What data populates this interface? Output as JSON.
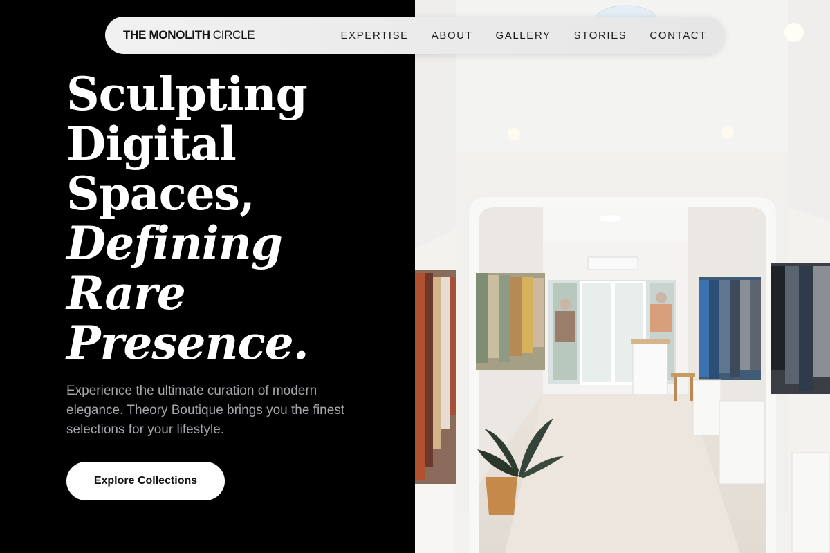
{
  "nav": {
    "logo_bold": "THE MONOLITH",
    "logo_thin": "CIRCLE",
    "links": [
      "EXPERTISE",
      "ABOUT",
      "GALLERY",
      "STORIES",
      "CONTACT"
    ]
  },
  "hero": {
    "headline_lines": [
      "Sculpting",
      "Digital",
      "Spaces,",
      "Defining",
      "Rare",
      "Presence."
    ],
    "subtext": "Experience the ultimate curation of modern elegance. Theory Boutique brings you the finest selections for your lifestyle.",
    "cta_label": "Explore Collections"
  },
  "image": {
    "subject": "boutique-interior-photo"
  },
  "colors": {
    "background": "#000000",
    "nav_background": "#ececec",
    "headline": "#ffffff",
    "subtext": "#a6a6ac",
    "cta_background": "#ffffff",
    "cta_text": "#111111"
  }
}
